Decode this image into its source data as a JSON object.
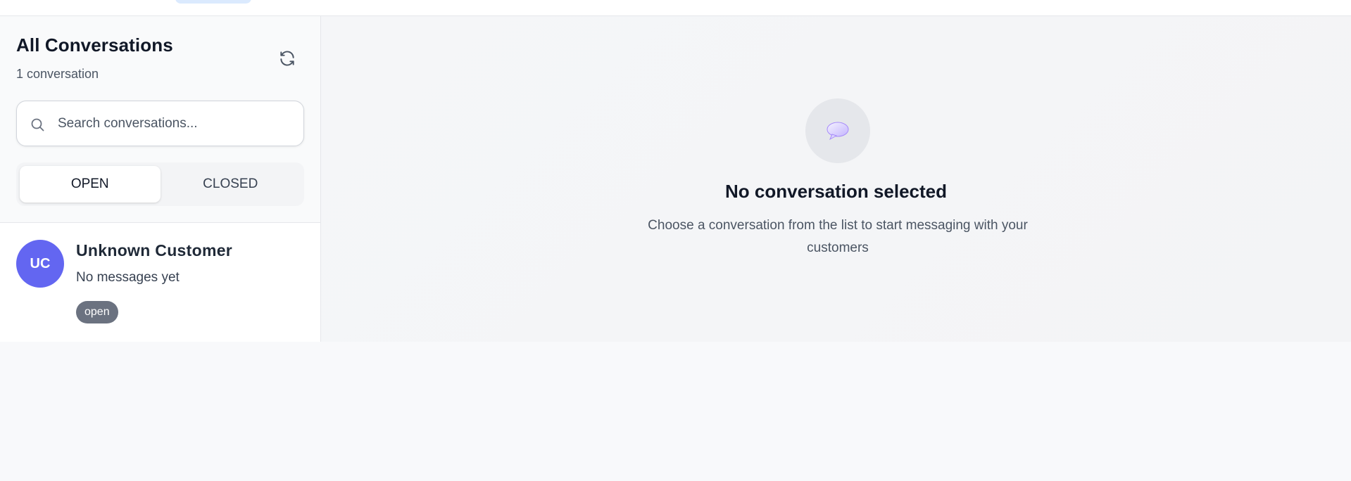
{
  "sidebar": {
    "title": "All Conversations",
    "count_text": "1 conversation",
    "search": {
      "placeholder": "Search conversations..."
    },
    "tabs": [
      {
        "label": "OPEN",
        "active": true
      },
      {
        "label": "CLOSED",
        "active": false
      }
    ],
    "conversations": [
      {
        "initials": "UC",
        "name": "Unknown Customer",
        "preview": "No messages yet",
        "status": "open",
        "avatar_color": "#6366f1"
      }
    ]
  },
  "main": {
    "empty_state": {
      "icon": "speech-bubble-icon",
      "title": "No conversation selected",
      "subtitle": "Choose a conversation from the list to start messaging with your customers"
    }
  },
  "colors": {
    "accent": "#6366f1",
    "badge": "#6b7280",
    "highlight": "#dbeafe"
  }
}
